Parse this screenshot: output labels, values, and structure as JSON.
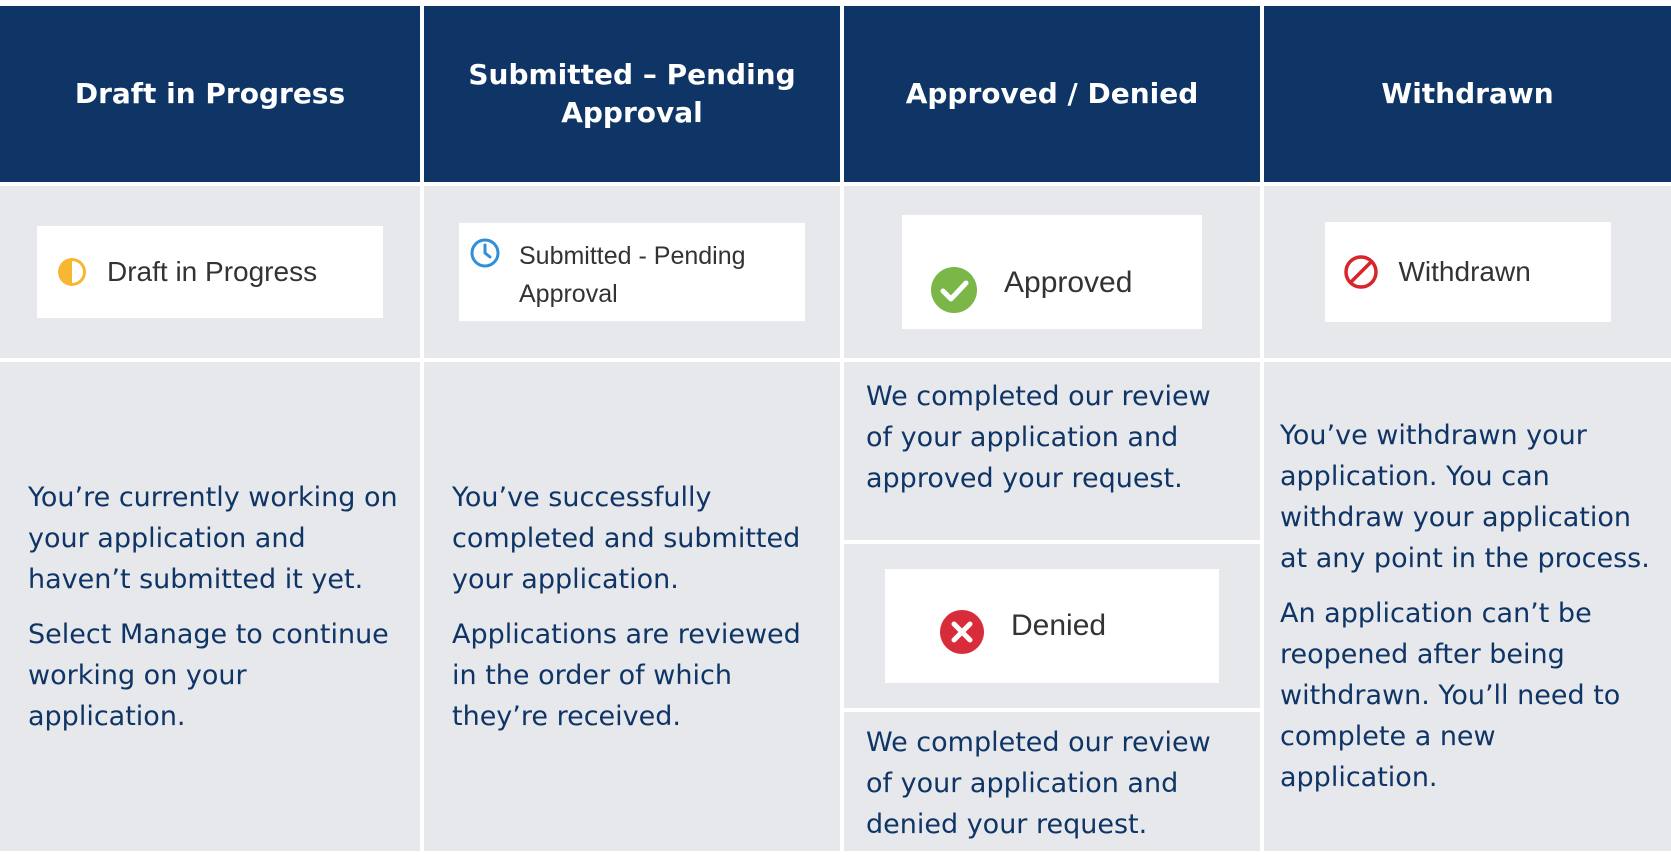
{
  "headers": [
    "Draft in Progress",
    "Submitted – Pending Approval",
    "Approved / Denied",
    "Withdrawn"
  ],
  "badges": {
    "draft": {
      "label": "Draft in Progress",
      "icon": "half-circle-icon",
      "color": "#f7b733"
    },
    "submitted": {
      "label": "Submitted - Pending Approval",
      "icon": "clock-icon",
      "color": "#2f8fd8"
    },
    "approved": {
      "label": "Approved",
      "icon": "check-circle-icon",
      "color": "#7ab648"
    },
    "denied": {
      "label": "Denied",
      "icon": "x-circle-icon",
      "color": "#d92c3a"
    },
    "withdrawn": {
      "label": "Withdrawn",
      "icon": "prohibited-icon",
      "color": "#d9242c"
    }
  },
  "descriptions": {
    "draft": [
      "You’re currently working on your application and haven’t submitted it yet.",
      "Select Manage to continue working on your application."
    ],
    "submitted": [
      "You’ve successfully completed and submitted your application.",
      "Applications are reviewed in the order of which they’re received."
    ],
    "approved": "We completed our review of your application and approved your request.",
    "denied": "We completed our review of your application and denied your request.",
    "withdrawn": [
      "You’ve withdrawn your application. You can withdraw your application at any point in the process.",
      "An application can’t be reopened after being withdrawn. You’ll need to complete a new application."
    ]
  },
  "colors": {
    "header_bg": "#0f3566",
    "body_bg": "#e7e8ec",
    "text": "#0f3566"
  }
}
